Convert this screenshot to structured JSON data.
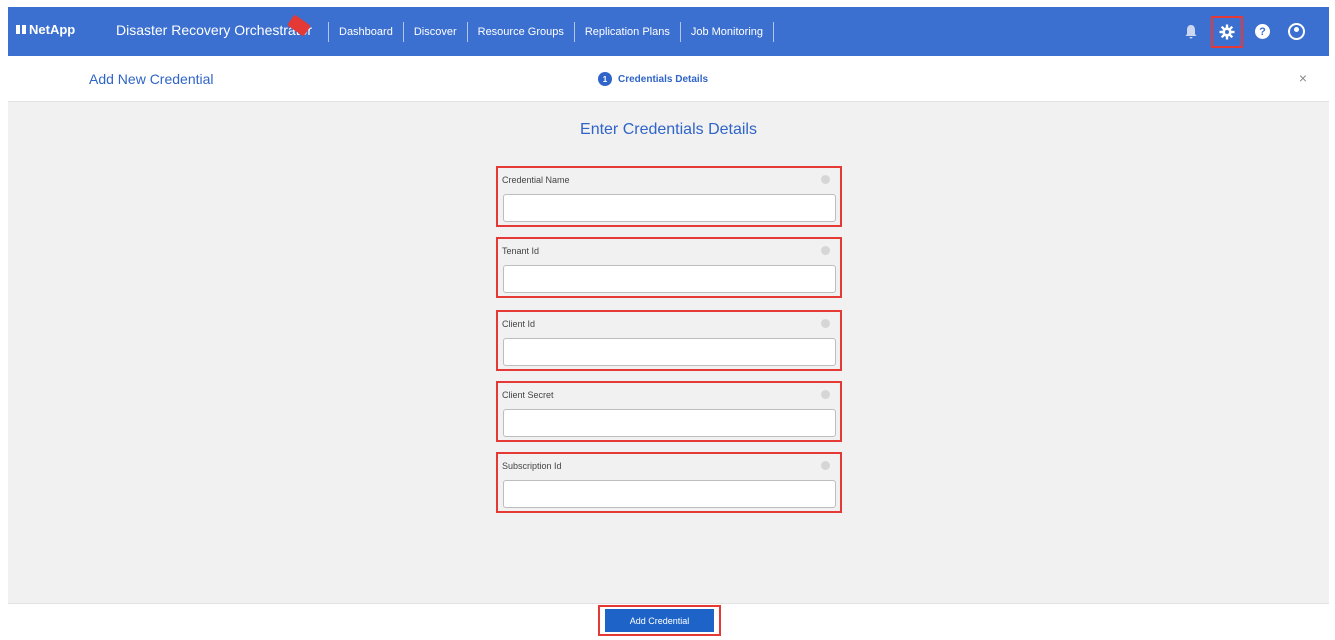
{
  "header": {
    "logo": "NetApp",
    "app_title": "Disaster Recovery Orchestrator",
    "nav": [
      "Dashboard",
      "Discover",
      "Resource Groups",
      "Replication Plans",
      "Job Monitoring"
    ],
    "icons": [
      "bell-icon",
      "gear-icon",
      "help-icon",
      "user-icon"
    ],
    "help_glyph": "?"
  },
  "subheader": {
    "title": "Add New Credential",
    "step_number": "1",
    "step_label": "Credentials Details",
    "close_glyph": "×"
  },
  "form": {
    "title": "Enter Credentials Details",
    "fields": [
      {
        "label": "Credential Name",
        "value": ""
      },
      {
        "label": "Tenant Id",
        "value": ""
      },
      {
        "label": "Client Id",
        "value": ""
      },
      {
        "label": "Client Secret",
        "value": ""
      },
      {
        "label": "Subscription Id",
        "value": ""
      }
    ]
  },
  "footer": {
    "submit_label": "Add Credential"
  },
  "colors": {
    "nav_bg": "#3b6fd0",
    "accent": "#2f64c8",
    "highlight": "#e53935",
    "button": "#1e63c7"
  }
}
